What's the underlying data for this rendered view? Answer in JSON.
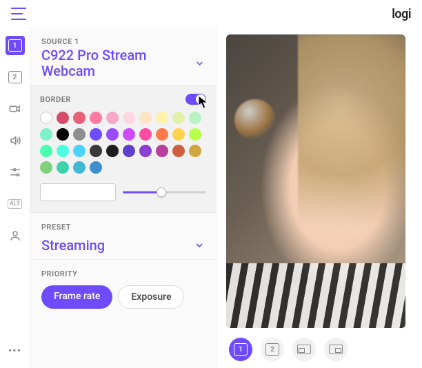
{
  "brand": "logi",
  "leftnav": {
    "sources": [
      "1",
      "2"
    ],
    "active_source_index": 0,
    "alt_label": "ALT"
  },
  "source_panel": {
    "label": "SOURCE 1",
    "name": "C922 Pro Stream Webcam"
  },
  "border": {
    "label": "BORDER",
    "enabled": true,
    "colors": [
      "#ffffff",
      "#d64d6c",
      "#e85f78",
      "#ff7aa2",
      "#f7a8c9",
      "#ffd6e2",
      "#ffe4c4",
      "#fff2a8",
      "#dff2a8",
      "#b8f2c0",
      "#7ff2cc",
      "#000000",
      "#8e8e8e",
      "#6e4bff",
      "#9b4bff",
      "#d04bff",
      "#ff4ba2",
      "#ff7a4b",
      "#ffd24b",
      "#b8ff4b",
      "#4bffb0",
      "#4bffe0",
      "#4bd2ff",
      "#3a3a3a",
      "#1f1f1f",
      "#5f3fd0",
      "#8a3fd0",
      "#b83f9e",
      "#d05f3f",
      "#d0a63f",
      "#7fd07a",
      "#3fd0b0",
      "#3fb8d0",
      "#3f8ed0"
    ],
    "slider_percent": 46
  },
  "preset": {
    "label": "PRESET",
    "value": "Streaming"
  },
  "priority": {
    "label": "PRIORITY",
    "options": [
      "Frame rate",
      "Exposure"
    ],
    "active_index": 0
  },
  "thumbs": {
    "items": [
      "1",
      "2",
      "pip-left",
      "pip-right"
    ],
    "active_index": 0
  }
}
